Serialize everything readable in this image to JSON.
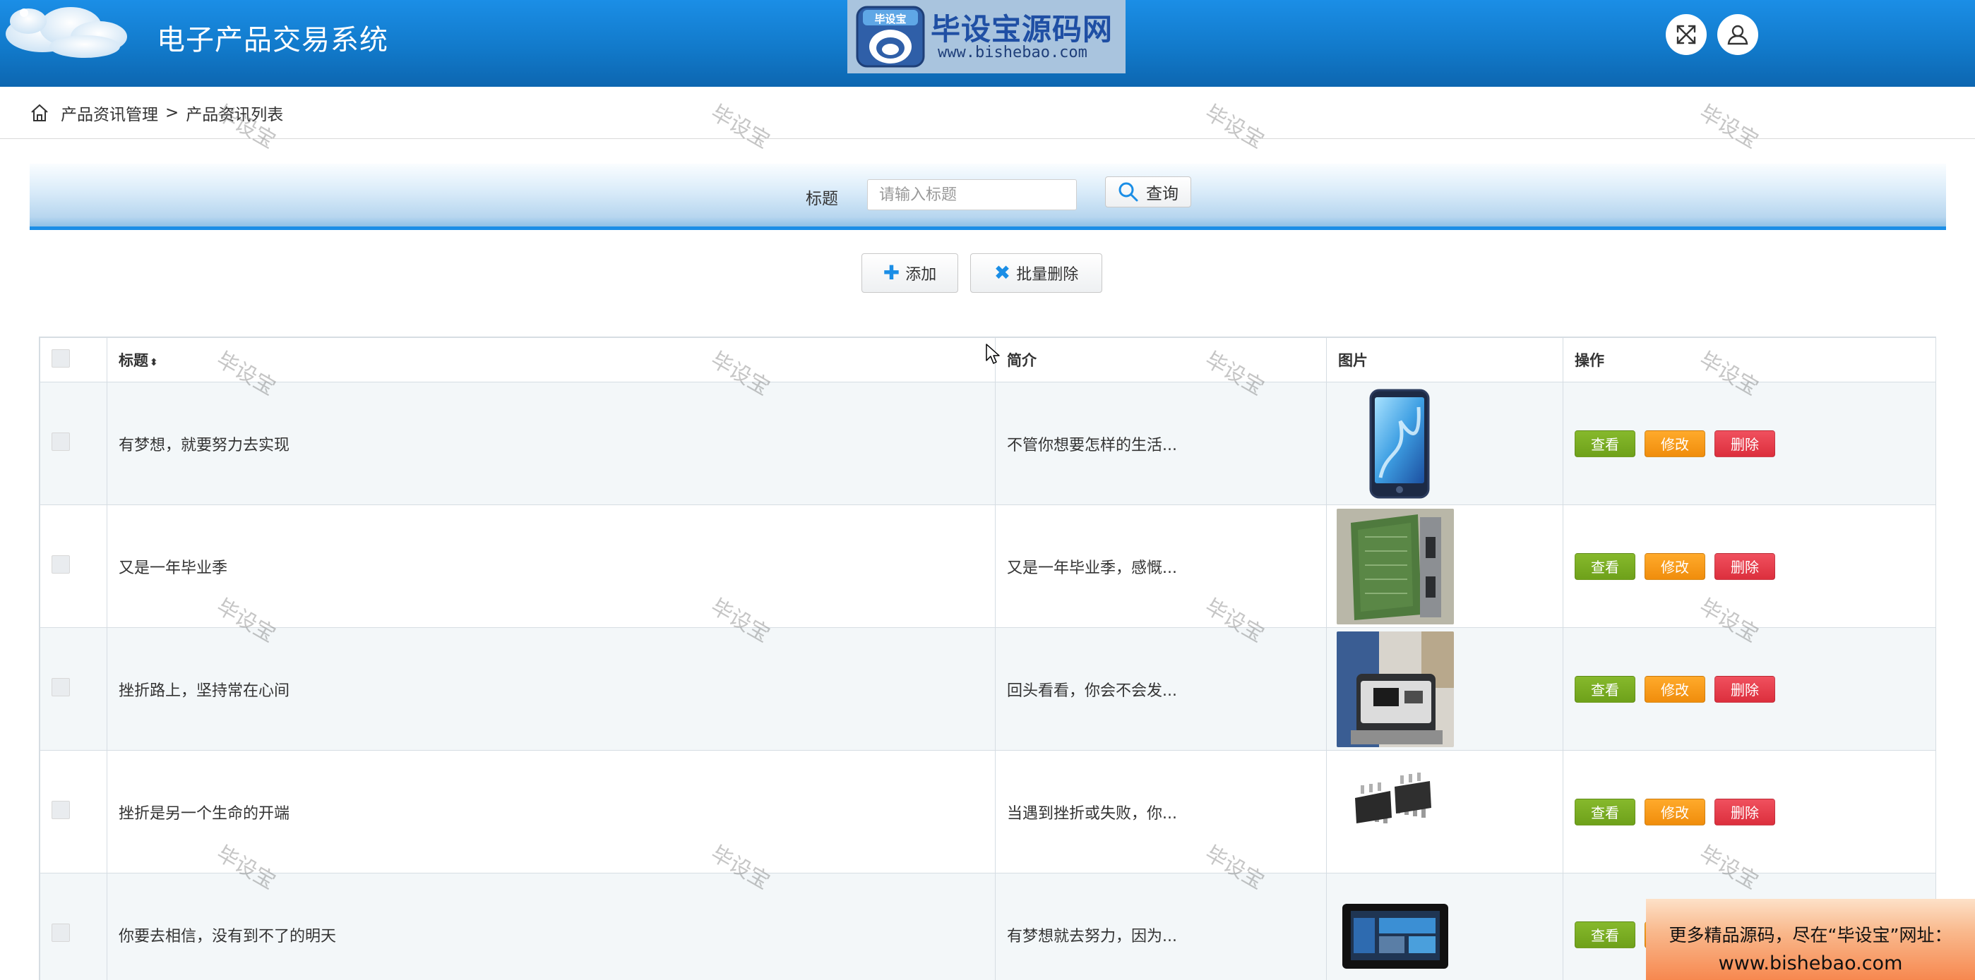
{
  "header": {
    "app_title": "电子产品交易系统",
    "logo_name": "毕设宝源码网",
    "logo_url": "www.bishebao.com",
    "logo_badge": "毕设宝",
    "fullscreen_icon": "expand-arrows-icon",
    "user_icon": "user-icon"
  },
  "breadcrumb": {
    "home_icon": "home-icon",
    "level1": "产品资讯管理",
    "separator": ">",
    "level2": "产品资讯列表"
  },
  "search": {
    "label": "标题",
    "placeholder": "请输入标题",
    "value": "",
    "button_label": "查询"
  },
  "actions": {
    "add_label": "添加",
    "batch_delete_label": "批量删除"
  },
  "table": {
    "columns": {
      "title": "标题",
      "summary": "简介",
      "image": "图片",
      "actions": "操作"
    },
    "buttons": {
      "view": "查看",
      "edit": "修改",
      "delete": "删除"
    },
    "rows": [
      {
        "title": "有梦想，就要努力去实现",
        "summary": "不管你想要怎样的生活...",
        "image": "smartphone"
      },
      {
        "title": "又是一年毕业季",
        "summary": "又是一年毕业季，感慨...",
        "image": "circuit-board"
      },
      {
        "title": "挫折路上，坚持常在心间",
        "summary": "回头看看，你会不会发...",
        "image": "power-station"
      },
      {
        "title": "挫折是另一个生命的开端",
        "summary": "当遇到挫折或失败，你...",
        "image": "ic-chip"
      },
      {
        "title": "你要去相信，没有到不了的明天",
        "summary": "有梦想就去努力，因为...",
        "image": "tablet-display"
      }
    ]
  },
  "watermark": "毕设宝",
  "promo": {
    "line1": "更多精品源码，尽在“毕设宝”网址：",
    "line2": "www.bishebao.com"
  },
  "colors": {
    "header": "#1178c8",
    "view_button": "#76aa20",
    "edit_button": "#f59818",
    "delete_button": "#e23a48"
  }
}
